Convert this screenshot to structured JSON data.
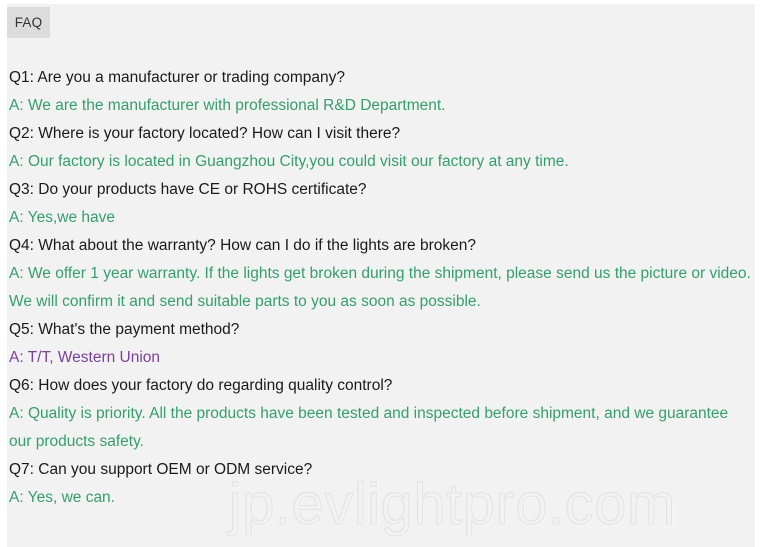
{
  "tabs": [
    {
      "label": "FAQ",
      "active": true
    }
  ],
  "faq": {
    "items": [
      {
        "question": "Q1: Are you a manufacturer or trading company?",
        "answer": "A: We are the manufacturer with professional R&D Department.",
        "answer_color": "#33a06c"
      },
      {
        "question": "Q2: Where is your factory located? How can I visit there?",
        "answer": "A: Our factory is located in Guangzhou City,you could visit our factory at any time.",
        "answer_color": "#33a06c"
      },
      {
        "question": "Q3: Do your products have CE or ROHS certificate?",
        "answer": "A: Yes,we have",
        "answer_color": "#33a06c"
      },
      {
        "question": "Q4: What about the warranty? How can I do if the lights are broken?",
        "answer": "A: We offer 1 year warranty. If the lights get broken during the shipment, please send us the picture or video. We will confirm it and send suitable parts to you as soon as possible.",
        "answer_color": "#33a06c"
      },
      {
        "question": "Q5: What's the payment method?",
        "answer": "A: T/T, Western Union",
        "answer_color": "#7b3f9d"
      },
      {
        "question": "Q6: How does your factory do regarding quality control?",
        "answer": "A: Quality is priority. All the products have been tested and inspected before shipment, and we guarantee our products safety.",
        "answer_color": "#33a06c"
      },
      {
        "question": "Q7: Can you support OEM or ODM service?",
        "answer": "A: Yes, we can.",
        "answer_color": "#33a06c"
      }
    ]
  },
  "watermark": {
    "text": "jp.evlightpro.com"
  },
  "colors": {
    "background": "#f2f2f2",
    "page": "#ffffff",
    "tab_active": "#dcdcdc",
    "question": "#1a1a1a",
    "answer_green": "#33a06c",
    "answer_purple": "#7b3f9d",
    "watermark": "#e4e4e4"
  }
}
